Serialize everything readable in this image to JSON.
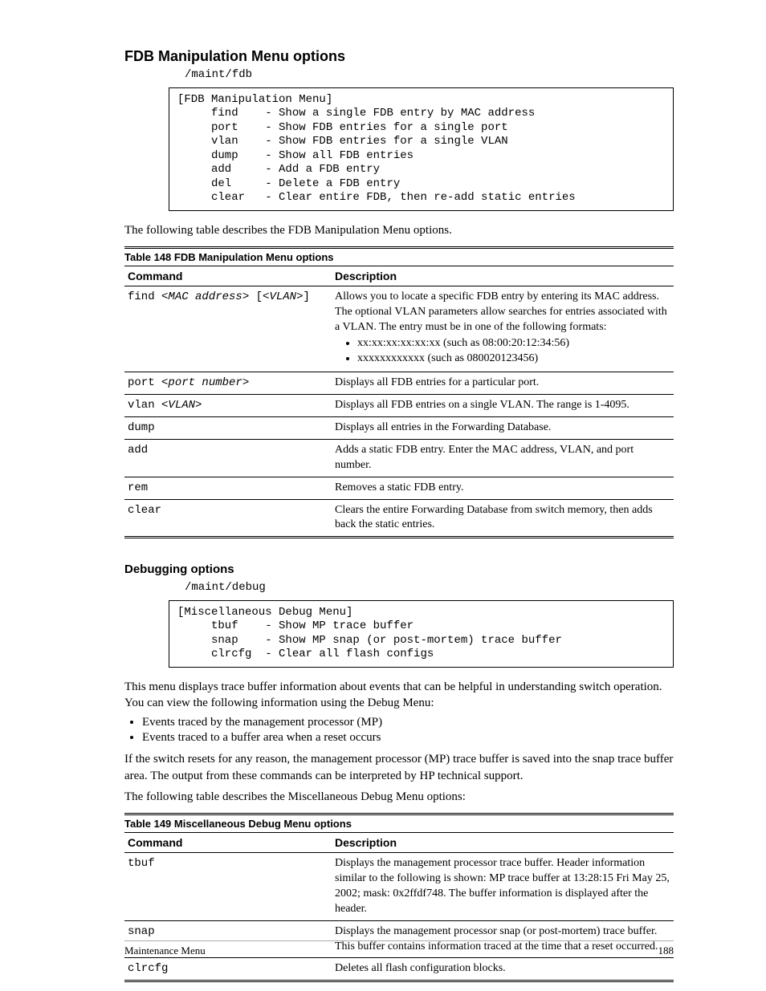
{
  "section1": {
    "heading": "FDB Manipulation Menu options",
    "intro": "The following table describes the FDB Manipulation Menu options.",
    "path": "/maint/fdb",
    "code": "[FDB Manipulation Menu]\n     find    - Show a single FDB entry by MAC address\n     port    - Show FDB entries for a single port\n     vlan    - Show FDB entries for a single VLAN\n     dump    - Show all FDB entries\n     add     - Add a FDB entry\n     del     - Delete a FDB entry\n     clear   - Clear entire FDB, then re-add static entries",
    "table_title": "Table 148 FDB Manipulation Menu options",
    "col1": "Command",
    "col2": "Description",
    "rows": [
      {
        "cmd": "find <MAC address> [<VLAN>]",
        "desc": "Allows you to locate a specific FDB entry by entering its MAC address. The optional VLAN parameters allow searches for entries associated with a VLAN. The entry must be in one of the following formats:",
        "bullets": [
          "xx:xx:xx:xx:xx:xx (such as 08:00:20:12:34:56)",
          "xxxxxxxxxxxx (such as 080020123456)"
        ]
      },
      {
        "cmd": "port <port number>",
        "desc": "Displays all FDB entries for a particular port."
      },
      {
        "cmd": "vlan <VLAN>",
        "desc": "Displays all FDB entries on a single VLAN. The range is 1-4095."
      },
      {
        "cmd": "dump",
        "desc": "Displays all entries in the Forwarding Database."
      },
      {
        "cmd": "add",
        "desc": "Adds a static FDB entry. Enter the MAC address, VLAN, and port number."
      },
      {
        "cmd": "rem",
        "desc": "Removes a static FDB entry."
      },
      {
        "cmd": "clear",
        "desc": "Clears the entire Forwarding Database from switch memory, then adds back the static entries."
      }
    ]
  },
  "section2": {
    "heading": "Debugging options",
    "path": "/maint/debug",
    "code": "[Miscellaneous Debug Menu]\n     tbuf    - Show MP trace buffer\n     snap    - Show MP snap (or post-mortem) trace buffer\n     clrcfg  - Clear all flash configs",
    "para1": "This menu displays trace buffer information about events that can be helpful in understanding switch operation. You can view the following information using the Debug Menu:",
    "bullets": [
      "Events traced by the management processor (MP)",
      "Events traced to a buffer area when a reset occurs"
    ],
    "para2": "If the switch resets for any reason, the management processor (MP) trace buffer is saved into the snap trace buffer area. The output from these commands can be interpreted by HP technical support.",
    "intro": "The following table describes the Miscellaneous Debug Menu options:",
    "table_title": "Table 149 Miscellaneous Debug Menu options",
    "col1": "Command",
    "col2": "Description",
    "rows": [
      {
        "cmd": "tbuf",
        "desc": "Displays the management processor trace buffer. Header information similar to the following is shown: MP trace buffer at 13:28:15 Fri May 25, 2002; mask: 0x2ffdf748. The buffer information is displayed after the header."
      },
      {
        "cmd": "snap",
        "desc": "Displays the management processor snap (or post-mortem) trace buffer. This buffer contains information traced at the time that a reset occurred."
      },
      {
        "cmd": "clrcfg",
        "desc": "Deletes all flash configuration blocks."
      }
    ]
  },
  "footer": {
    "left": "Maintenance Menu",
    "right": "188"
  }
}
